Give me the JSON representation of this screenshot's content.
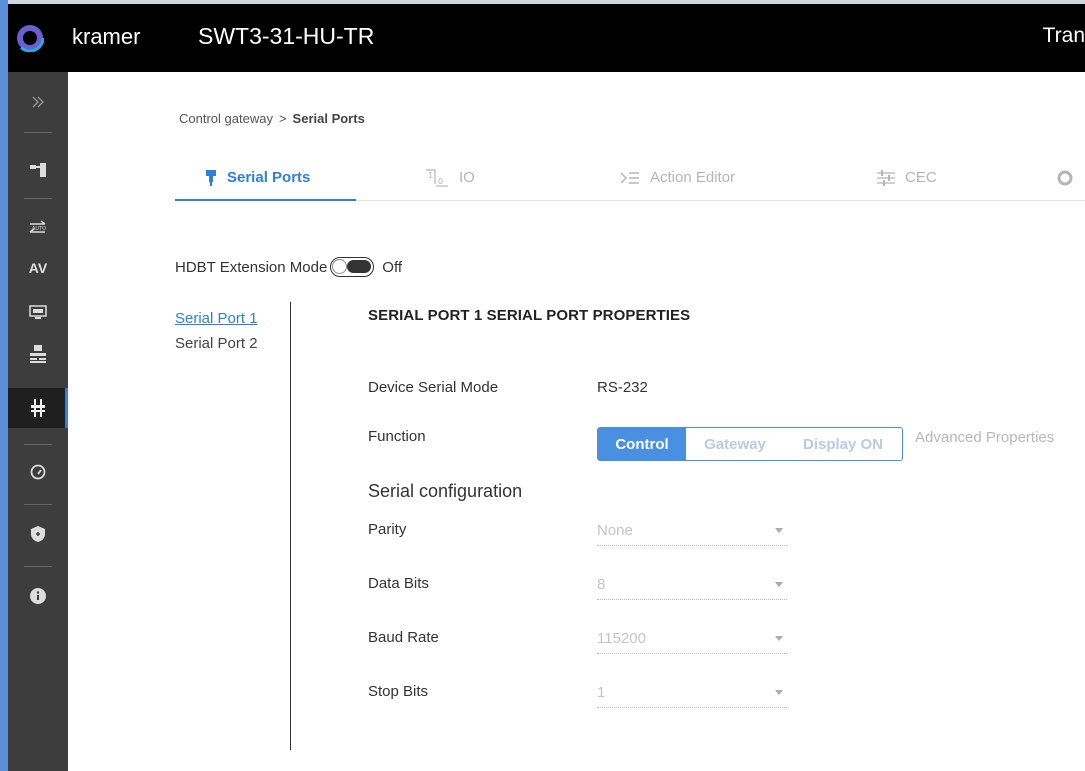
{
  "header": {
    "brand": "kramer",
    "device_name": "SWT3-31-HU-TR",
    "right_text": "Tran"
  },
  "sidebar": {
    "items": [
      {
        "icon": "expand-chevrons-icon"
      },
      {
        "icon": "routing-icon"
      },
      {
        "icon": "auto-switch-icon"
      },
      {
        "icon": "av-icon",
        "label": "AV"
      },
      {
        "icon": "edid-icon"
      },
      {
        "icon": "settings-panel-icon"
      },
      {
        "icon": "control-gateway-icon",
        "active": true
      },
      {
        "icon": "diagnostics-gauge-icon"
      },
      {
        "icon": "security-shield-icon"
      },
      {
        "icon": "info-icon"
      }
    ]
  },
  "breadcrumb": {
    "parent": "Control gateway",
    "separator": ">",
    "current": "Serial Ports"
  },
  "tabs": [
    {
      "label": "Serial Ports",
      "icon": "serial-port-icon",
      "active": true
    },
    {
      "label": "IO",
      "icon": "io-icon"
    },
    {
      "label": "Action Editor",
      "icon": "action-editor-icon"
    },
    {
      "label": "CEC",
      "icon": "cec-sliders-icon"
    }
  ],
  "hdbt": {
    "label": "HDBT Extension Mode",
    "state": "Off"
  },
  "ports": [
    "Serial Port 1",
    "Serial Port 2"
  ],
  "properties": {
    "title": "SERIAL PORT 1 SERIAL PORT PROPERTIES",
    "device_serial_mode_label": "Device Serial Mode",
    "device_serial_mode_value": "RS-232",
    "function_label": "Function",
    "function_options": [
      "Control",
      "Gateway",
      "Display ON"
    ],
    "function_selected": "Control",
    "advanced_label": "Advanced Properties"
  },
  "serial_config": {
    "heading": "Serial configuration",
    "fields": [
      {
        "label": "Parity",
        "value": "None"
      },
      {
        "label": "Data Bits",
        "value": "8"
      },
      {
        "label": "Baud Rate",
        "value": "115200"
      },
      {
        "label": "Stop Bits",
        "value": "1"
      }
    ]
  },
  "colors": {
    "accent": "#2f7fd8",
    "segment_selected": "#4a90e2",
    "sidebar_bg": "#3d3d3d",
    "header_bg": "#000000"
  }
}
